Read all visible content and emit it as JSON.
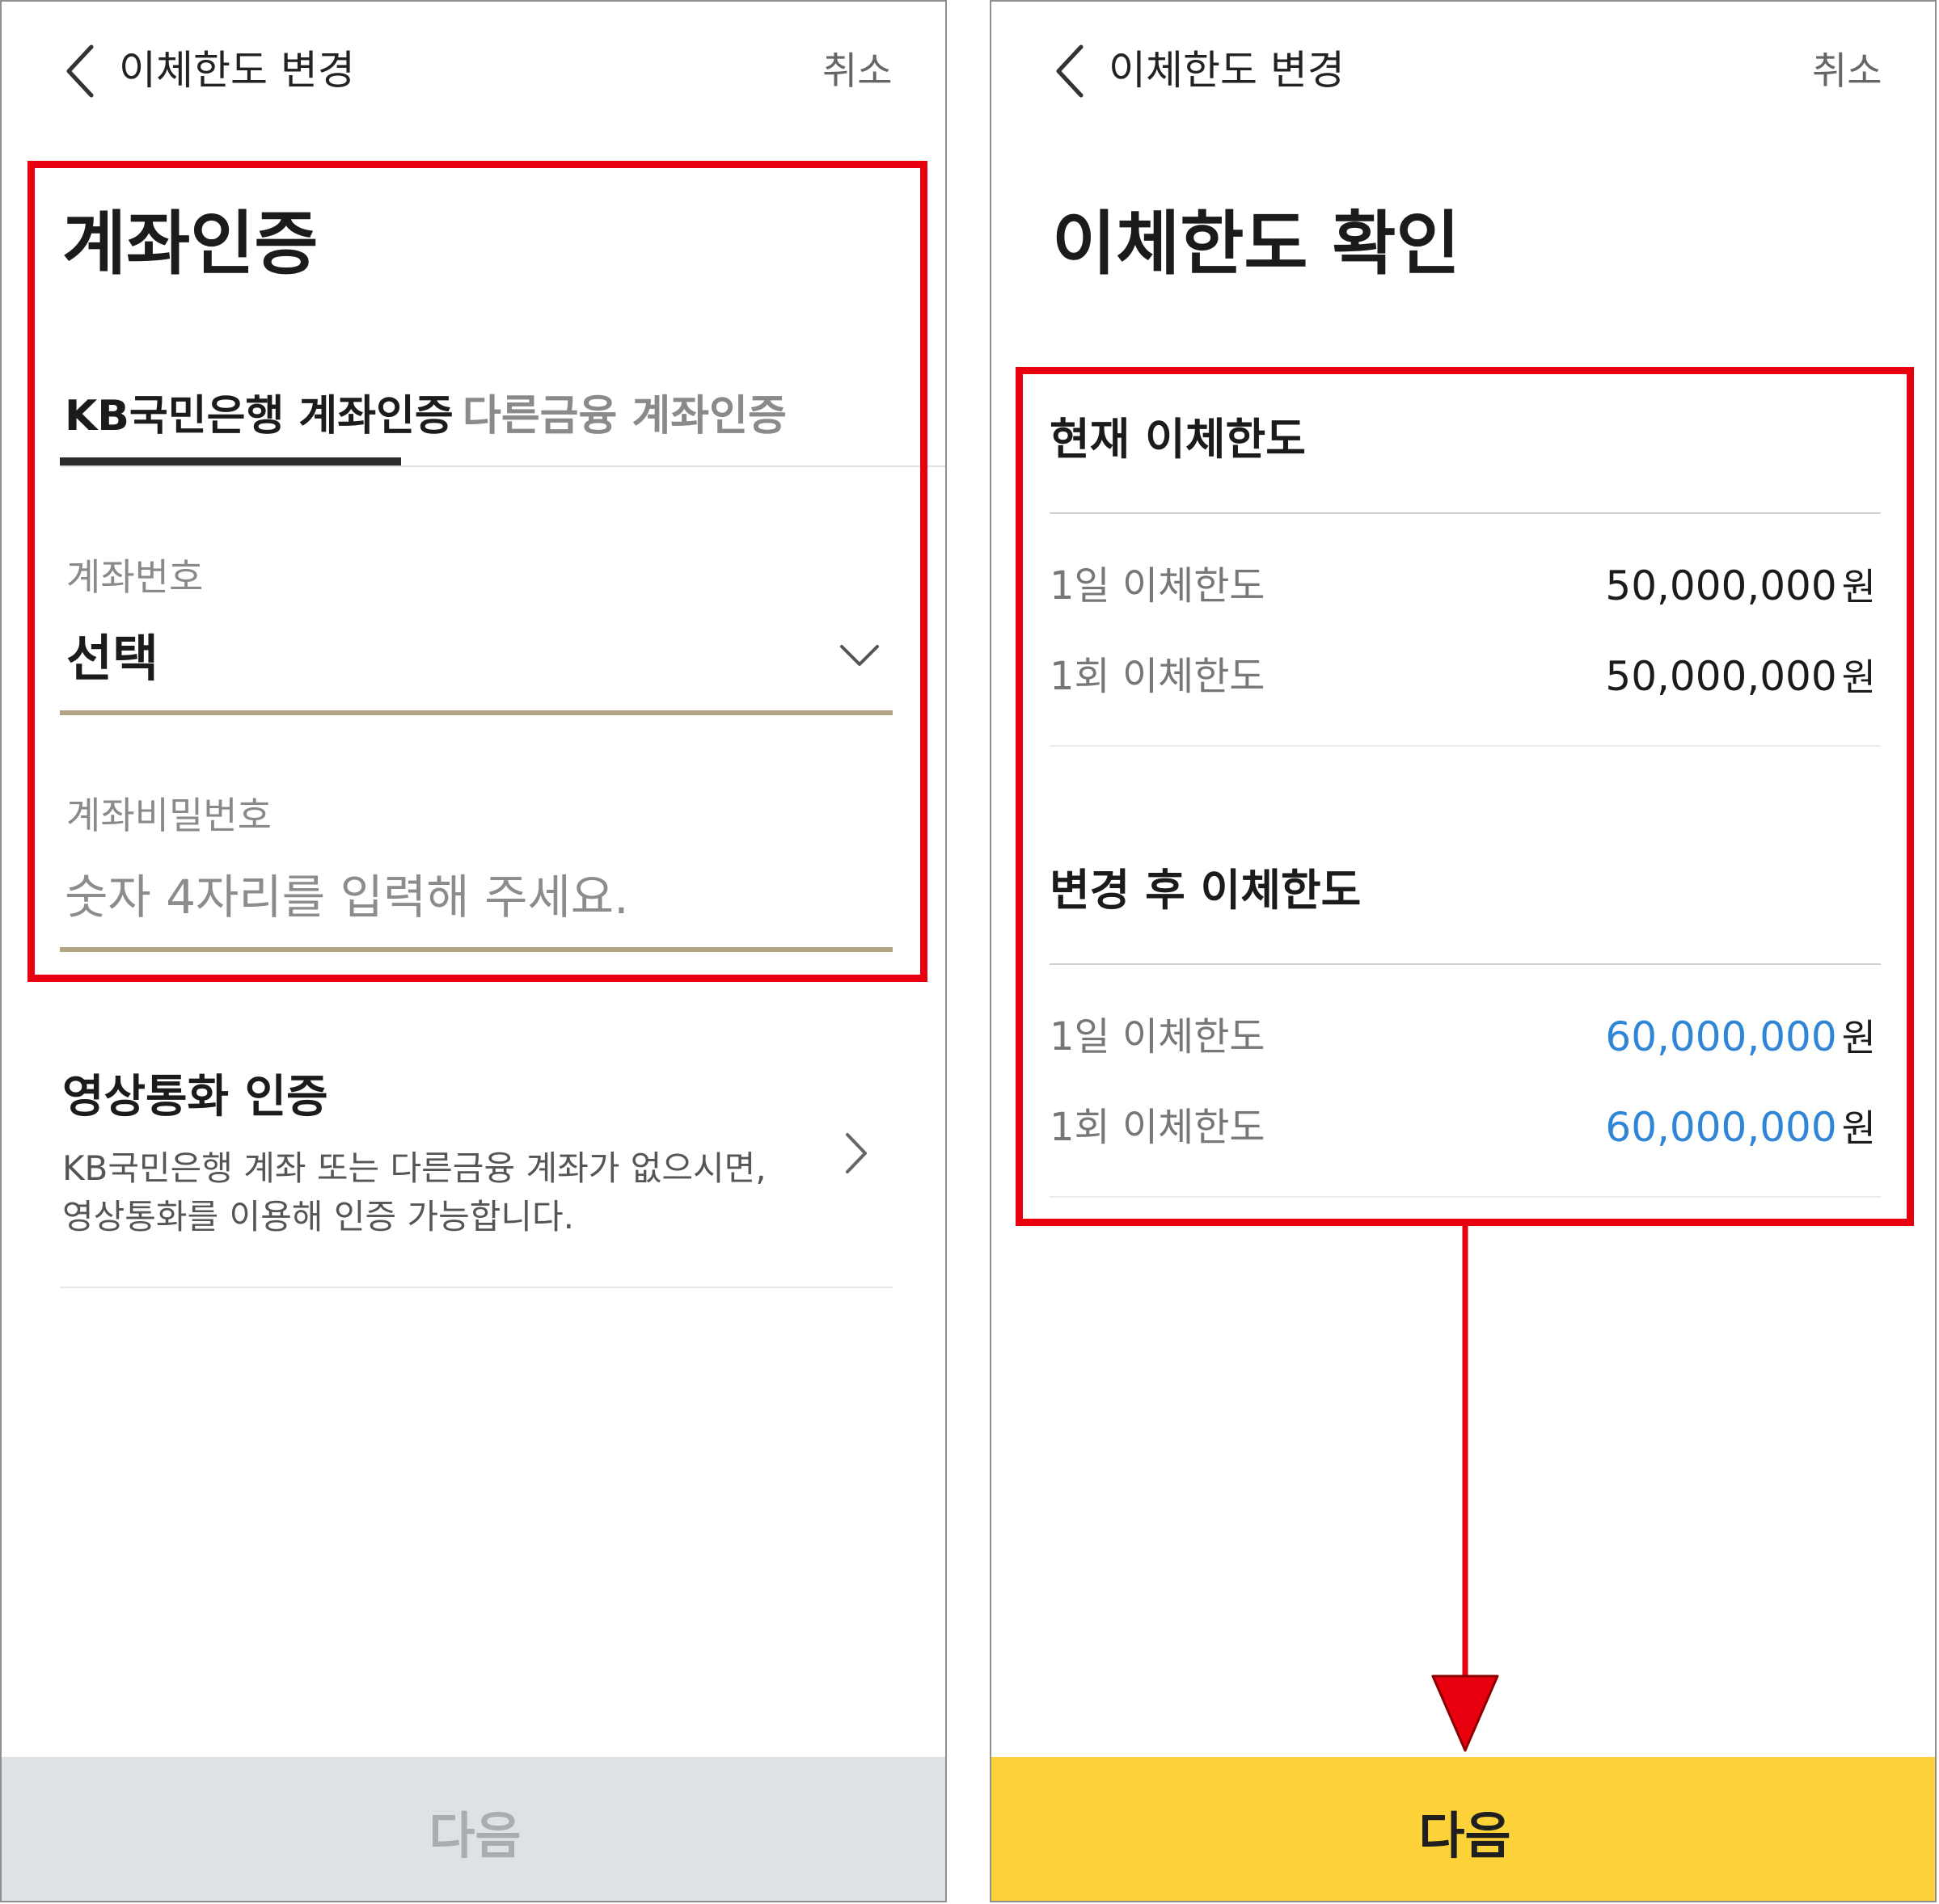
{
  "left": {
    "header": {
      "title": "이체한도 변경",
      "cancel": "취소"
    },
    "heading": "계좌인증",
    "tabs": [
      {
        "label": "KB국민은행 계좌인증",
        "active": true
      },
      {
        "label": "다른금융 계좌인증",
        "active": false
      }
    ],
    "account_number": {
      "label": "계좌번호",
      "value": "선택"
    },
    "account_password": {
      "label": "계좌비밀번호",
      "placeholder": "숫자 4자리를 입력해 주세요."
    },
    "video_call": {
      "title": "영상통화 인증",
      "desc_line1": "KB국민은행 계좌 또는 다른금융 계좌가 없으시면,",
      "desc_line2": "영상통화를 이용해 인증 가능합니다."
    },
    "next_button": "다음"
  },
  "right": {
    "header": {
      "title": "이체한도 변경",
      "cancel": "취소"
    },
    "heading": "이체한도 확인",
    "current": {
      "title": "현재 이체한도",
      "rows": [
        {
          "label": "1일 이체한도",
          "amount": "50,000,000",
          "unit": "원"
        },
        {
          "label": "1회 이체한도",
          "amount": "50,000,000",
          "unit": "원"
        }
      ]
    },
    "after": {
      "title": "변경 후 이체한도",
      "rows": [
        {
          "label": "1일 이체한도",
          "amount": "60,000,000",
          "unit": "원"
        },
        {
          "label": "1회 이체한도",
          "amount": "60,000,000",
          "unit": "원"
        }
      ]
    },
    "next_button": "다음"
  },
  "colors": {
    "highlight_red": "#e8000f",
    "accent_yellow": "#fdd239",
    "new_amount_blue": "#2f86d6",
    "field_underline": "#b0a482",
    "disabled_button": "#dfe2e4"
  }
}
